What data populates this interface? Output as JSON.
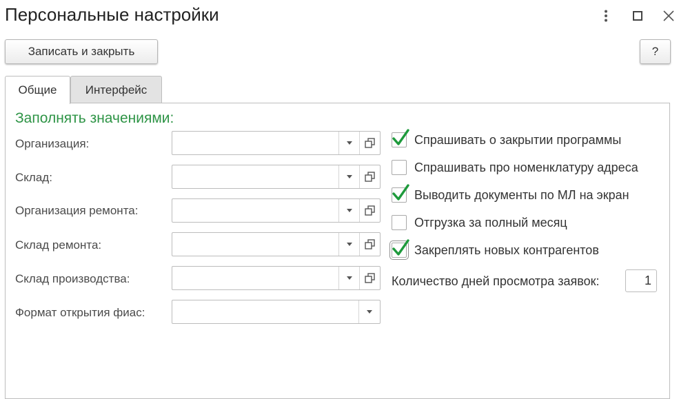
{
  "window": {
    "title": "Персональные настройки",
    "controls": [
      "more-vertical-icon",
      "maximize-icon",
      "close-icon"
    ]
  },
  "toolbar": {
    "save_close_label": "Записать и закрыть",
    "help_label": "?"
  },
  "tabs": [
    {
      "label": "Общие",
      "active": true
    },
    {
      "label": "Интерфейс",
      "active": false
    }
  ],
  "section": {
    "title": "Заполнять значениями:"
  },
  "fields": [
    {
      "label": "Организация:",
      "value": ""
    },
    {
      "label": "Склад:",
      "value": ""
    },
    {
      "label": "Организация ремонта:",
      "value": ""
    },
    {
      "label": "Склад ремонта:",
      "value": ""
    },
    {
      "label": "Склад производства:",
      "value": ""
    },
    {
      "label": "Формат открытия фиас:",
      "value": ""
    }
  ],
  "checkboxes": [
    {
      "label": "Спрашивать о закрытии программы",
      "checked": true
    },
    {
      "label": "Спрашивать про номенклатуру адреса",
      "checked": false
    },
    {
      "label": "Выводить документы по МЛ на экран",
      "checked": true
    },
    {
      "label": "Отгрузка за полный месяц",
      "checked": false
    },
    {
      "label": "Закреплять новых контрагентов",
      "checked": true
    }
  ],
  "days": {
    "label": "Количество дней просмотра заявок:",
    "value": "1"
  },
  "colors": {
    "accent_green": "#2e9446",
    "check_green": "#1e9a3c",
    "border": "#bdbdbd"
  }
}
